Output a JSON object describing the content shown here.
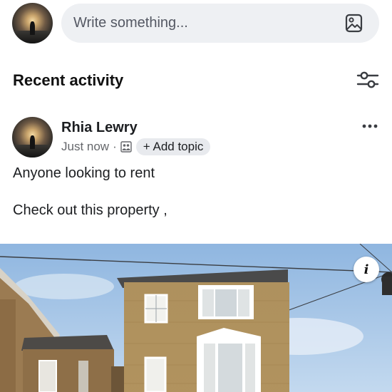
{
  "composer": {
    "placeholder": "Write something...",
    "avatar_icon": "user-avatar",
    "photo_icon": "photo-icon"
  },
  "feed": {
    "section_title": "Recent activity",
    "filter_icon": "filter-sliders-icon"
  },
  "post": {
    "author": "Rhia Lewry",
    "time": "Just now",
    "separator": "·",
    "audience_icon": "group-icon",
    "add_topic_label": "+ Add topic",
    "more_icon": "more-options-icon",
    "lines": [
      "Anyone looking to rent",
      "Check out this property ,"
    ],
    "photo_icon": "info-icon"
  },
  "colors": {
    "text": "#1c1e21",
    "secondary_text": "#65676b",
    "input_bg": "#eef0f3",
    "chip_bg": "#e8eaee",
    "sky": "#a9c8e8",
    "brick": "#b08f57"
  }
}
